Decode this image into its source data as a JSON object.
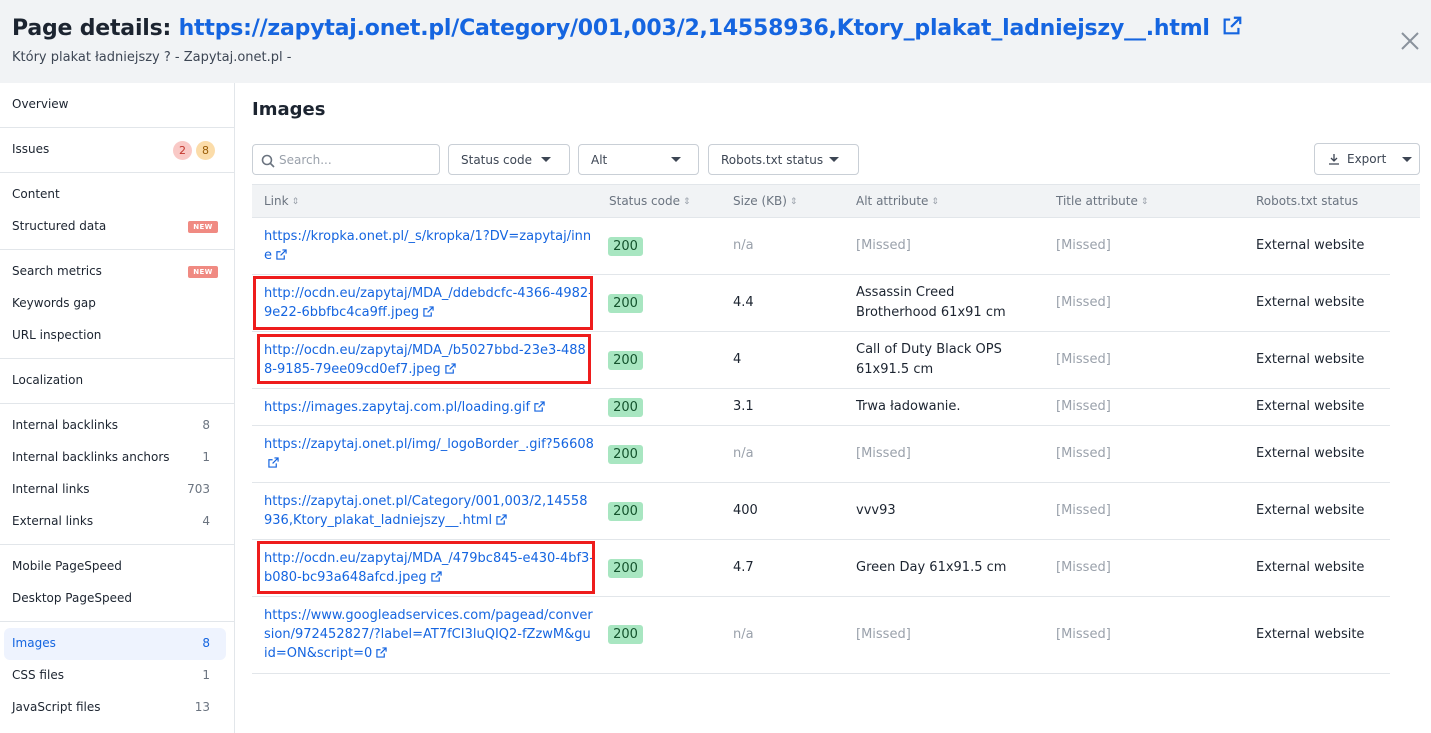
{
  "header": {
    "label": "Page details:",
    "url": "https://zapytaj.onet.pl/Category/001,003/2,14558936,Ktory_plakat_ladniejszy__.html",
    "subtitle": "Który plakat ładniejszy ? - Zapytaj.onet.pl -"
  },
  "sidebar": {
    "overview": "Overview",
    "issues": {
      "label": "Issues",
      "errors": "2",
      "warnings": "8"
    },
    "content": "Content",
    "structured_data": {
      "label": "Structured data",
      "badge": "NEW"
    },
    "search_metrics": {
      "label": "Search metrics",
      "badge": "NEW"
    },
    "keywords_gap": "Keywords gap",
    "url_inspection": "URL inspection",
    "localization": "Localization",
    "internal_backlinks": {
      "label": "Internal backlinks",
      "count": "8"
    },
    "internal_backlinks_anchors": {
      "label": "Internal backlinks anchors",
      "count": "1"
    },
    "internal_links": {
      "label": "Internal links",
      "count": "703"
    },
    "external_links": {
      "label": "External links",
      "count": "4"
    },
    "mobile_pagespeed": "Mobile PageSpeed",
    "desktop_pagespeed": "Desktop PageSpeed",
    "images": {
      "label": "Images",
      "count": "8"
    },
    "css_files": {
      "label": "CSS files",
      "count": "1"
    },
    "javascript_files": {
      "label": "JavaScript files",
      "count": "13"
    }
  },
  "main": {
    "title": "Images",
    "search_placeholder": "Search...",
    "filters": {
      "status_code": "Status code",
      "alt": "Alt",
      "robots": "Robots.txt status"
    },
    "export_label": "Export",
    "columns": {
      "link": "Link",
      "status_code": "Status code",
      "size": "Size (KB)",
      "alt": "Alt attribute",
      "title": "Title attribute",
      "robots": "Robots.txt status"
    },
    "rows": [
      {
        "link": "https://kropka.onet.pl/_s/kropka/1?DV=zapytaj/inne",
        "status": "200",
        "size": "n/a",
        "alt": "[Missed]",
        "title": "[Missed]",
        "robots": "External website"
      },
      {
        "link": "http://ocdn.eu/zapytaj/MDA_/ddebdcfc-4366-4982-9e22-6bbfbc4ca9ff.jpeg",
        "status": "200",
        "size": "4.4",
        "alt": "Assassin Creed Brotherhood 61x91 cm",
        "title": "[Missed]",
        "robots": "External website"
      },
      {
        "link": "http://ocdn.eu/zapytaj/MDA_/b5027bbd-23e3-4888-9185-79ee09cd0ef7.jpeg",
        "status": "200",
        "size": "4",
        "alt": "Call of Duty Black OPS 61x91.5 cm",
        "title": "[Missed]",
        "robots": "External website"
      },
      {
        "link": "https://images.zapytaj.com.pl/loading.gif",
        "status": "200",
        "size": "3.1",
        "alt": "Trwa ładowanie.",
        "title": "[Missed]",
        "robots": "External website"
      },
      {
        "link": "https://zapytaj.onet.pl/img/_logoBorder_.gif?56608",
        "status": "200",
        "size": "n/a",
        "alt": "[Missed]",
        "title": "[Missed]",
        "robots": "External website"
      },
      {
        "link": "https://zapytaj.onet.pl/Category/001,003/2,14558936,Ktory_plakat_ladniejszy__.html",
        "status": "200",
        "size": "400",
        "alt": "vvv93",
        "title": "[Missed]",
        "robots": "External website"
      },
      {
        "link": "http://ocdn.eu/zapytaj/MDA_/479bc845-e430-4bf3-b080-bc93a648afcd.jpeg",
        "status": "200",
        "size": "4.7",
        "alt": "Green Day 61x91.5 cm",
        "title": "[Missed]",
        "robots": "External website"
      },
      {
        "link": "https://www.googleadservices.com/pagead/conversion/972452827/?label=AT7fCI3luQIQ2-fZzwM&guid=ON&script=0",
        "status": "200",
        "size": "n/a",
        "alt": "[Missed]",
        "title": "[Missed]",
        "robots": "External website"
      }
    ]
  },
  "colors": {
    "accent": "#1565e0",
    "success_badge": "#a8e6c1",
    "highlight_box": "#ee1c1c",
    "new_badge": "#f08a82"
  }
}
